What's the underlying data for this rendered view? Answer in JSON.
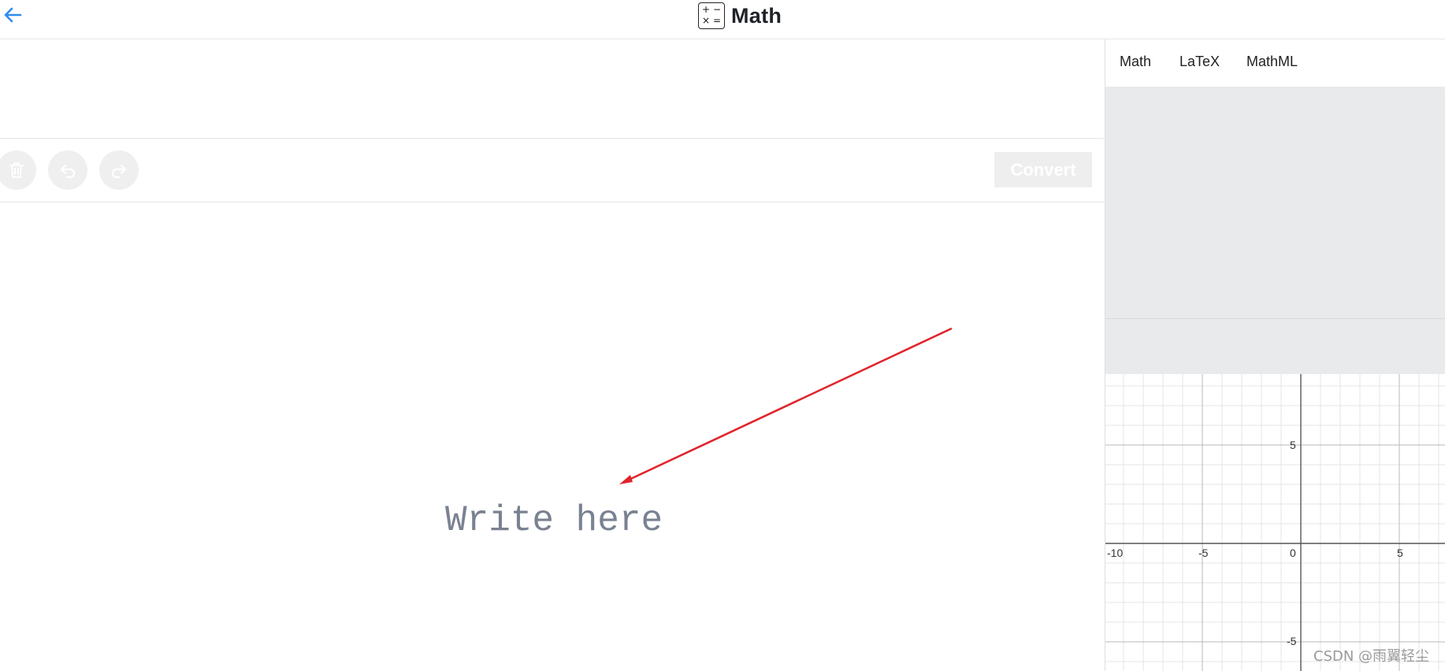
{
  "header": {
    "title": "Math",
    "icon_symbols": [
      "+",
      "−",
      "×",
      "="
    ]
  },
  "toolbar": {
    "convert_label": "Convert"
  },
  "editor": {
    "placeholder": "Write here"
  },
  "tabs": [
    {
      "label": "Math"
    },
    {
      "label": "LaTeX"
    },
    {
      "label": "MathML"
    }
  ],
  "graph": {
    "x_ticks": [
      "-10",
      "-5",
      "0",
      "5"
    ],
    "y_ticks": [
      "5",
      "-5"
    ]
  },
  "watermark": "CSDN @雨翼轻尘",
  "colors": {
    "accent": "#2f8cf0",
    "arrow": "#e0242b"
  },
  "icons": [
    "back-arrow-icon",
    "math-app-icon",
    "trash-icon",
    "undo-icon",
    "redo-icon"
  ]
}
